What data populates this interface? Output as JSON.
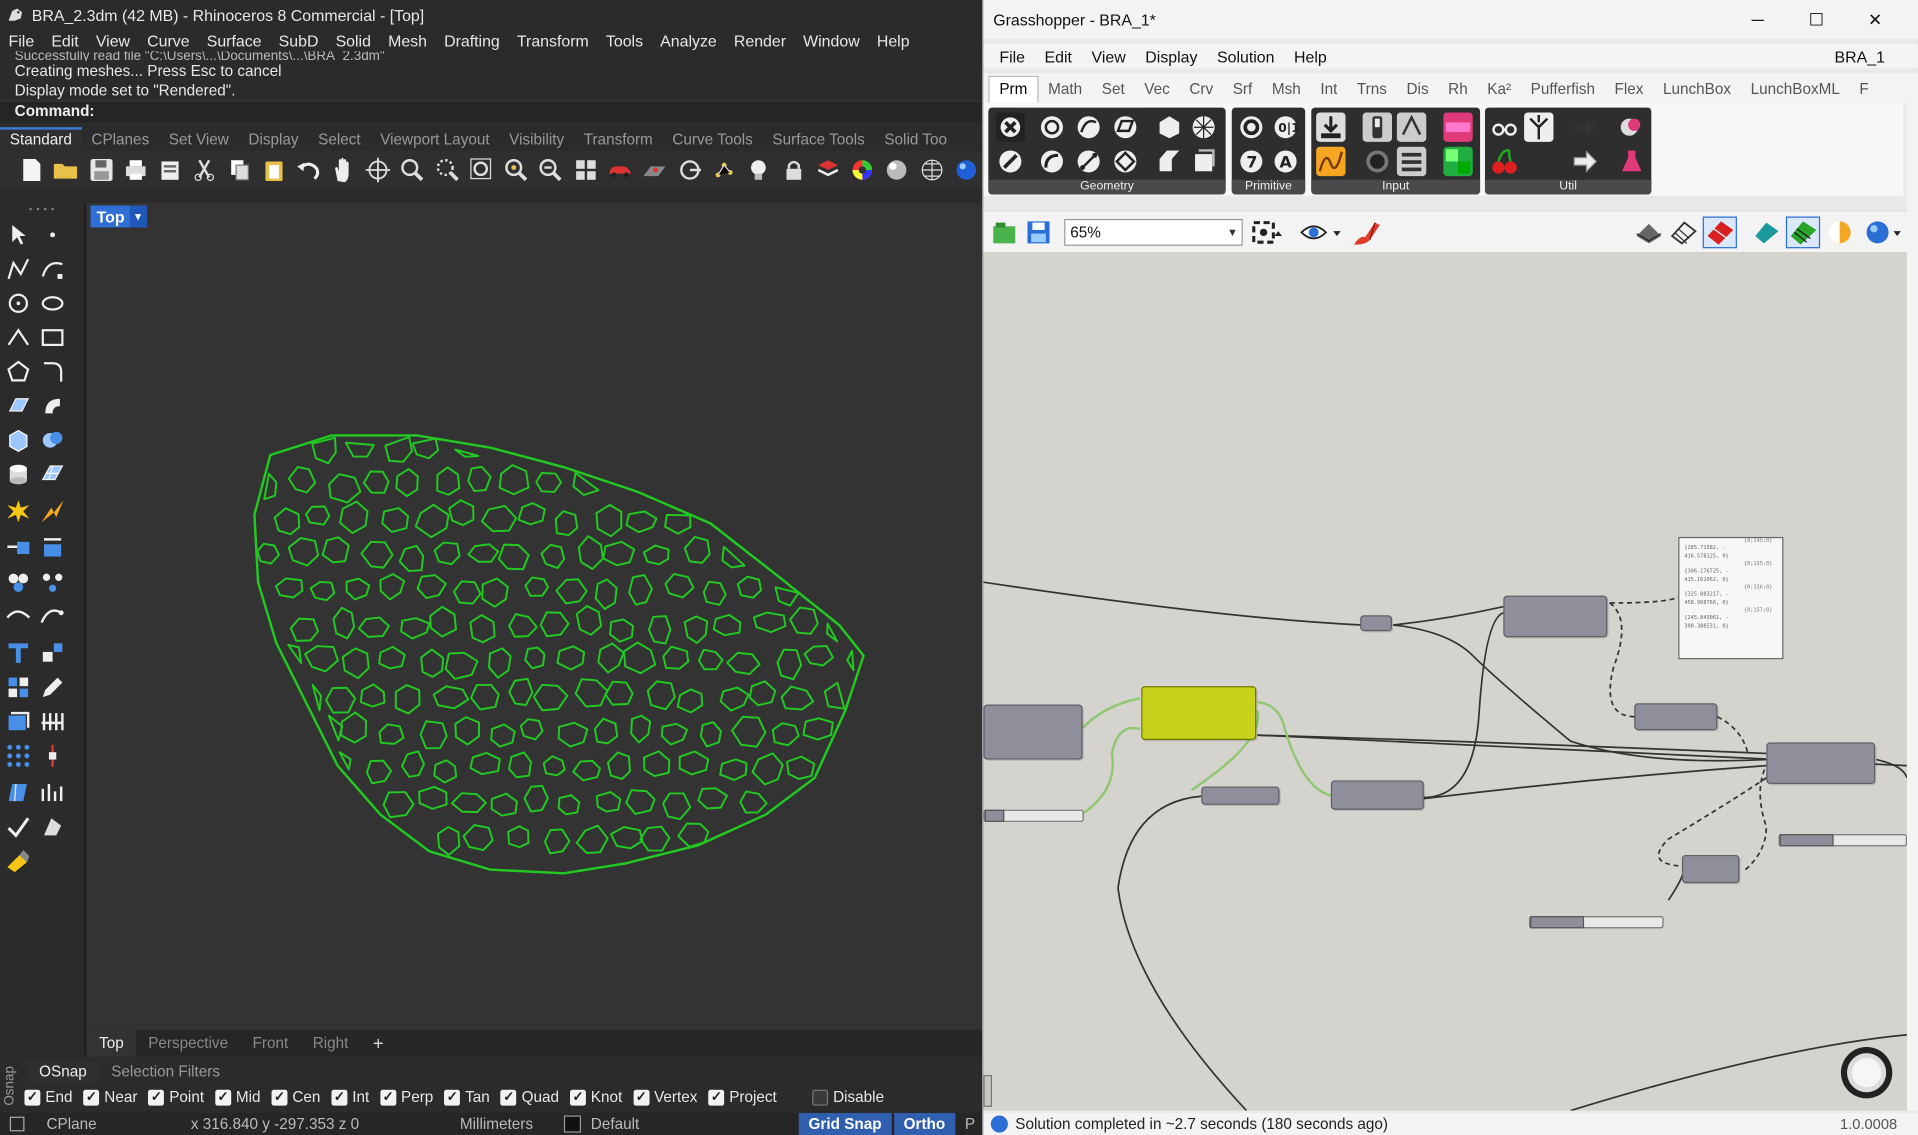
{
  "rhino": {
    "title": "BRA_2.3dm (42 MB) - Rhinoceros 8 Commercial - [Top]",
    "menu": [
      "File",
      "Edit",
      "View",
      "Curve",
      "Surface",
      "SubD",
      "Solid",
      "Mesh",
      "Drafting",
      "Transform",
      "Tools",
      "Analyze",
      "Render",
      "Window",
      "Help"
    ],
    "history": [
      "Successfully read file \"C:\\Users\\...\\Documents\\...\\BRA_2.3dm\"",
      "Creating meshes... Press Esc to cancel",
      "Display mode set to \"Rendered\"."
    ],
    "command_prompt": "Command:",
    "toolbar_tabs": [
      "Standard",
      "CPlanes",
      "Set View",
      "Display",
      "Select",
      "Viewport Layout",
      "Visibility",
      "Transform",
      "Curve Tools",
      "Surface Tools",
      "Solid Too"
    ],
    "active_toolbar_tab": "Standard",
    "viewport": {
      "label": "Top",
      "dropdown": "▾",
      "curve_color": "#22c922",
      "background": "#333333"
    },
    "viewport_tabs": [
      "Top",
      "Perspective",
      "Front",
      "Right",
      "+"
    ],
    "osnap_panel_label": "Osnap",
    "osnap_tabs": [
      "OSnap",
      "Selection Filters"
    ],
    "osnaps": [
      {
        "label": "End",
        "checked": true
      },
      {
        "label": "Near",
        "checked": true
      },
      {
        "label": "Point",
        "checked": true
      },
      {
        "label": "Mid",
        "checked": true
      },
      {
        "label": "Cen",
        "checked": true
      },
      {
        "label": "Int",
        "checked": true
      },
      {
        "label": "Perp",
        "checked": true
      },
      {
        "label": "Tan",
        "checked": true
      },
      {
        "label": "Quad",
        "checked": true
      },
      {
        "label": "Knot",
        "checked": true
      },
      {
        "label": "Vertex",
        "checked": true
      },
      {
        "label": "Project",
        "checked": true
      },
      {
        "label": "Disable",
        "checked": false
      }
    ],
    "status": {
      "cplane": "CPlane",
      "coords": "x 316.840  y -297.353  z 0",
      "units": "Millimeters",
      "layer": "Default",
      "grid_snap": "Grid Snap",
      "ortho": "Ortho",
      "more": "P"
    }
  },
  "gh": {
    "title": "Grasshopper - BRA_1*",
    "window_controls": {
      "minimize": "─",
      "maximize": "☐",
      "close": "✕"
    },
    "menu": [
      "File",
      "Edit",
      "View",
      "Display",
      "Solution",
      "Help"
    ],
    "doc_name": "BRA_1",
    "tabs": [
      "Prm",
      "Math",
      "Set",
      "Vec",
      "Crv",
      "Srf",
      "Msh",
      "Int",
      "Trns",
      "Dis",
      "Rh",
      "Ka²",
      "Pufferfish",
      "Flex",
      "LunchBox",
      "LunchBoxML",
      "F"
    ],
    "active_tab": "Prm",
    "ribbon_groups": [
      "Geometry",
      "Primitive",
      "Input",
      "Util"
    ],
    "zoom": "65%",
    "panel_rows": [
      {
        "text": "{285.71582, -",
        "index": "{0;145;0}"
      },
      {
        "text": "416.578125, 0}",
        "index": ""
      },
      {
        "text": "{306.176725, -",
        "index": "{0;155;0}"
      },
      {
        "text": "415.162062, 0}",
        "index": ""
      },
      {
        "text": "{325.883217, -",
        "index": "{0;156;0}"
      },
      {
        "text": "458.908766, 0}",
        "index": ""
      },
      {
        "text": "{245.843061, -",
        "index": "{0;157;0}"
      },
      {
        "text": "398.388531, 0}",
        "index": ""
      }
    ],
    "status_text": "Solution completed in ~2.7 seconds (180 seconds ago)",
    "version": "1.0.0008"
  }
}
